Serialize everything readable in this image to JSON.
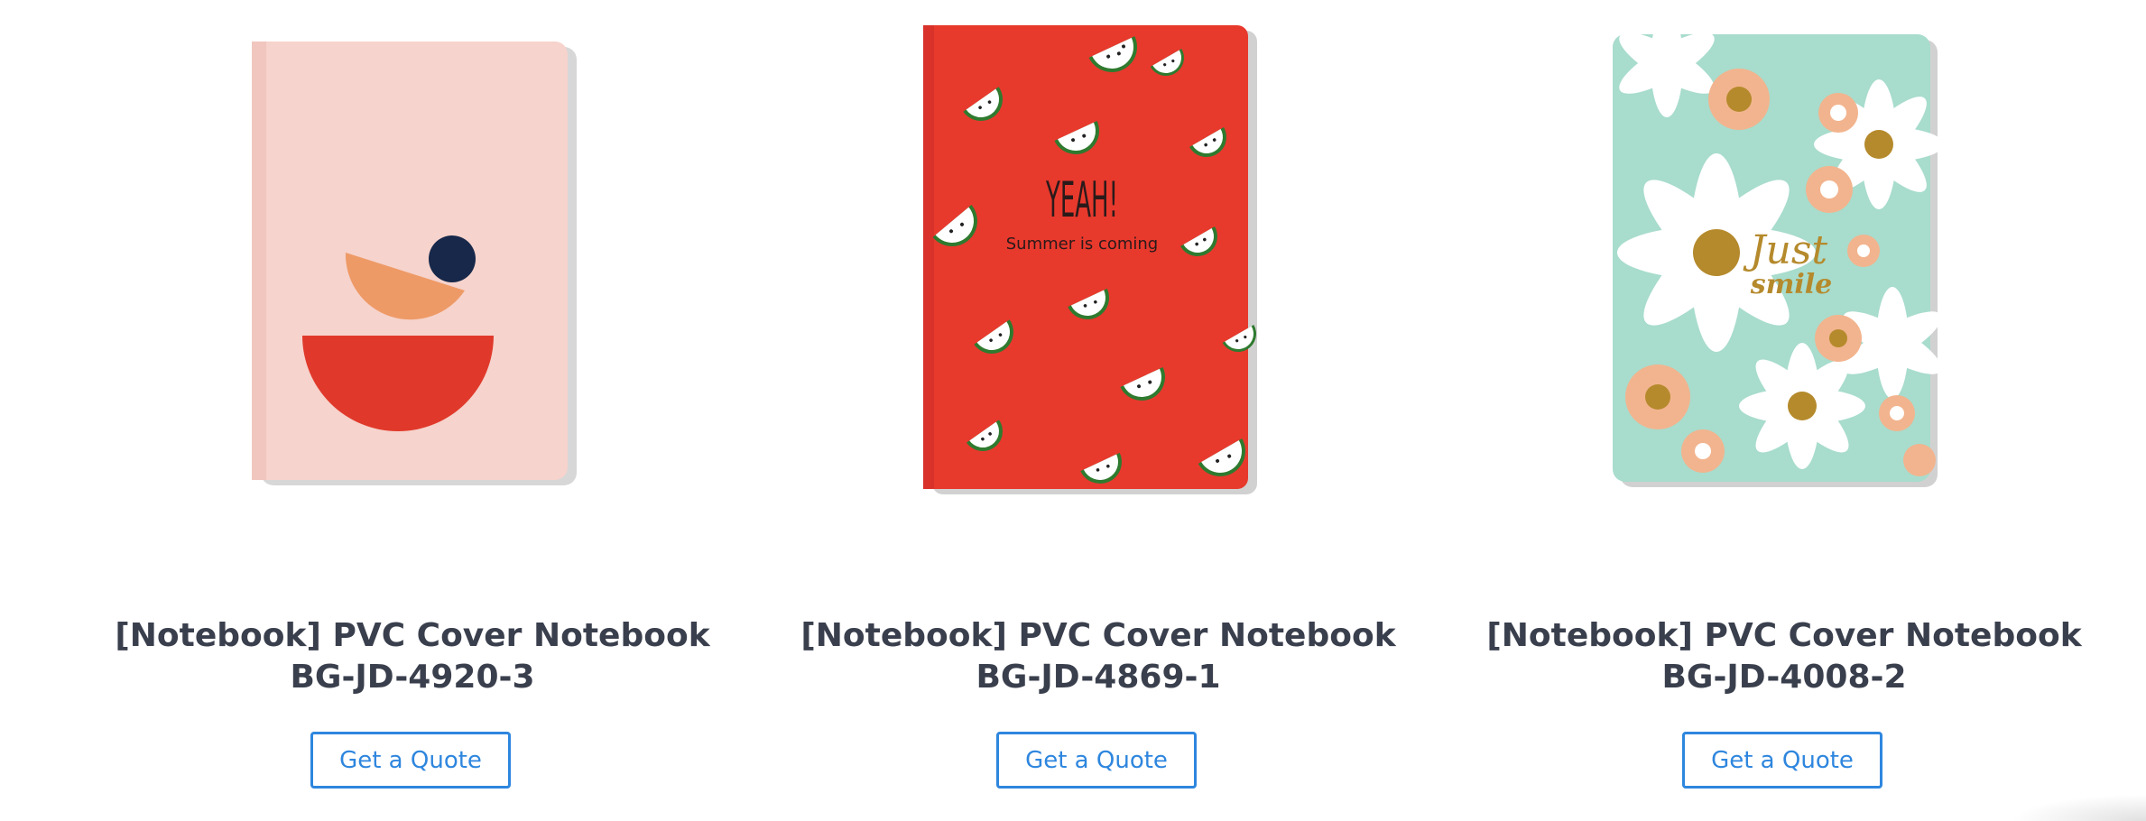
{
  "products": [
    {
      "title": "[Notebook] PVC Cover Notebook BG-JD-4920-3",
      "button_label": "Get a Quote",
      "image": {
        "icon": "notebook-geometric-cover",
        "colors": {
          "cover": "#f6d3cc",
          "half_moon": "#e0392b",
          "arc": "#ee9a67",
          "dot": "#17284a"
        }
      }
    },
    {
      "title": "[Notebook] PVC Cover Notebook BG-JD-4869-1",
      "button_label": "Get a Quote",
      "image": {
        "icon": "notebook-watermelon-cover",
        "cover_text": "YEAH!",
        "cover_subtext": "Summer is coming",
        "colors": {
          "cover": "#e8392d"
        }
      }
    },
    {
      "title": "[Notebook] PVC Cover Notebook BG-JD-4008-2",
      "button_label": "Get a Quote",
      "image": {
        "icon": "notebook-daisy-cover",
        "cover_text": "Just",
        "cover_subtext": "smile",
        "colors": {
          "cover": "#a8dccd",
          "petal": "#ffffff",
          "flower": "#f2b48e",
          "center": "#b58a2c"
        }
      }
    }
  ],
  "colors": {
    "title": "#3a3f4d",
    "button": "#2e86de"
  }
}
